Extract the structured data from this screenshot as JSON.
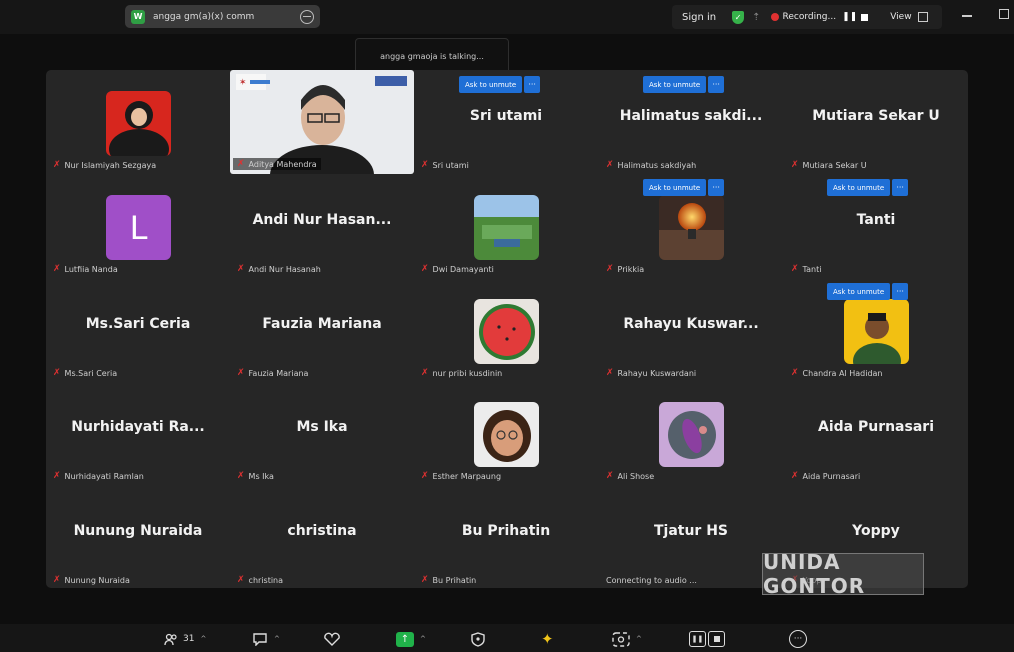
{
  "topbar": {
    "meeting_title": "angga gm(a)(x) comm",
    "sign_in": "Sign in",
    "recording": "Recording...",
    "view": "View"
  },
  "talking_banner": "angga gmaoja is talking...",
  "unmute_label": "Ask to unmute",
  "tiles": [
    {
      "label": "Nur Islamiyah Sezgaya",
      "big": "",
      "avatar": "hijab"
    },
    {
      "label": "Aditya Mahendra",
      "big": "",
      "avatar": "video"
    },
    {
      "label": "Sri utami",
      "big": "Sri utami",
      "avatar": ""
    },
    {
      "label": "Halimatus sakdiyah",
      "big": "Halimatus  sakdi...",
      "avatar": ""
    },
    {
      "label": "Mutiara Sekar U",
      "big": "Mutiara Sekar U",
      "avatar": ""
    },
    {
      "label": "Lutfiia Nanda",
      "big": "",
      "avatar": "letter"
    },
    {
      "label": "Andi Nur Hasanah",
      "big": "Andi Nur Hasan...",
      "avatar": ""
    },
    {
      "label": "Dwi Damayanti",
      "big": "",
      "avatar": "landscape"
    },
    {
      "label": "Prikkia",
      "big": "",
      "avatar": "bulb"
    },
    {
      "label": "Tanti",
      "big": "Tanti",
      "avatar": ""
    },
    {
      "label": "Ms.Sari Ceria",
      "big": "Ms.Sari Ceria",
      "avatar": ""
    },
    {
      "label": "Fauzia Mariana",
      "big": "Fauzia Mariana",
      "avatar": ""
    },
    {
      "label": "nur pribi kusdinin",
      "big": "",
      "avatar": "melon"
    },
    {
      "label": "Rahayu Kuswardani",
      "big": "Rahayu  Kuswar...",
      "avatar": ""
    },
    {
      "label": "Chandra Al Hadidan",
      "big": "",
      "avatar": "person"
    },
    {
      "label": "Nurhidayati Ramlan",
      "big": "Nurhidayati  Ra...",
      "avatar": ""
    },
    {
      "label": "Ms Ika",
      "big": "Ms Ika",
      "avatar": ""
    },
    {
      "label": "Esther Marpaung",
      "big": "",
      "avatar": "cartoon"
    },
    {
      "label": "Ali Shose",
      "big": "",
      "avatar": "food"
    },
    {
      "label": "Aida Purnasari",
      "big": "Aida Purnasari",
      "avatar": ""
    },
    {
      "label": "Nunung Nuraida",
      "big": "Nunung Nuraida",
      "avatar": ""
    },
    {
      "label": "christina",
      "big": "christina",
      "avatar": ""
    },
    {
      "label": "Bu Prihatin",
      "big": "Bu Prihatin",
      "avatar": ""
    },
    {
      "label": "Connecting to audio ...",
      "big": "Tjatur HS",
      "avatar": ""
    },
    {
      "label": "Yoppy",
      "big": "Yoppy",
      "avatar": ""
    }
  ],
  "avatar_letter": "L",
  "participants_count": "31",
  "watermark": "UNIDA GONTOR",
  "colors": {
    "accent": "#1f6fd6",
    "muted_mic": "#e03131",
    "share_green": "#20b24a"
  }
}
